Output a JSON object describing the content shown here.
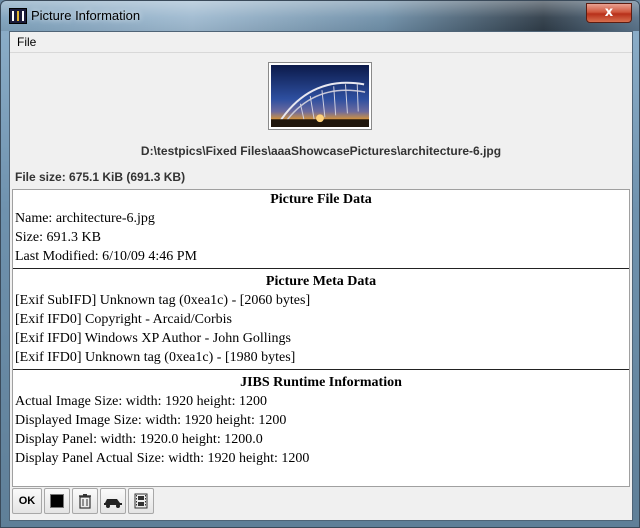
{
  "window": {
    "title": "Picture Information",
    "close_glyph": "x"
  },
  "menu": {
    "file": "File"
  },
  "picture": {
    "path": "D:\\testpics\\Fixed Files\\aaaShowcasePictures\\architecture-6.jpg",
    "file_size_text": "File size: 675.1 KiB (691.3 KB)"
  },
  "sections": {
    "file_data": {
      "title": "Picture File Data",
      "lines": [
        "Name: architecture-6.jpg",
        "Size: 691.3 KB",
        "Last Modified: 6/10/09 4:46 PM"
      ]
    },
    "meta_data": {
      "title": "Picture Meta Data",
      "lines": [
        "[Exif SubIFD] Unknown tag (0xea1c) - [2060 bytes]",
        "[Exif IFD0] Copyright - Arcaid/Corbis",
        "[Exif IFD0] Windows XP Author - John Gollings",
        "[Exif IFD0] Unknown tag (0xea1c) - [1980 bytes]"
      ]
    },
    "runtime": {
      "title": "JIBS Runtime Information",
      "lines": [
        "Actual Image Size: width: 1920 height: 1200",
        "Displayed Image Size: width: 1920 height: 1200",
        "Display Panel: width: 1920.0 height: 1200.0",
        "Display Panel Actual Size: width: 1920 height: 1200"
      ]
    }
  },
  "toolbar": {
    "ok": "OK",
    "icons": [
      "black-square-icon",
      "trash-icon",
      "car-icon",
      "film-icon"
    ]
  }
}
